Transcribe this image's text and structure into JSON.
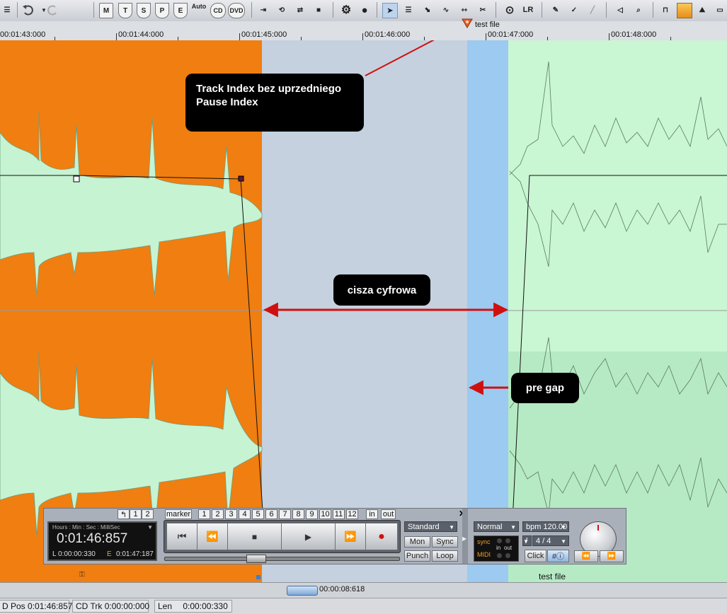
{
  "toolbar": {
    "buttons": [
      "M",
      "T",
      "S",
      "P",
      "E",
      "Auto",
      "CD",
      "DVD"
    ]
  },
  "ruler": {
    "marker_label": "test file",
    "ticks": [
      "00:01:43:000",
      "00:01:44:000",
      "00:01:45:000",
      "00:01:46:000",
      "00:01:47:000",
      "00:01:48:000"
    ]
  },
  "annotations": {
    "track_index": "Track Index bez uprzedniego\nPause Index",
    "silence": "cisza cyfrowa",
    "pregap": "pre gap"
  },
  "track": {
    "bottom_label": "test file"
  },
  "transport": {
    "top_numbers": [
      "1",
      "2"
    ],
    "marker_label": "marker",
    "marker_numbers": [
      "1",
      "2",
      "3",
      "4",
      "5",
      "6",
      "7",
      "8",
      "9",
      "10",
      "11",
      "12"
    ],
    "in_label": "in",
    "out_label": "out",
    "time_header": "Hours : Min :  Sec : MilliSec",
    "time_main": "0:01:46:857",
    "time_l_prefix": "L",
    "time_l": "0:00:00:330",
    "time_e_prefix": "E",
    "time_e": "0:01:47:187",
    "mode_standard": "Standard",
    "mon": "Mon",
    "sync": "Sync",
    "punch": "Punch",
    "loop": "Loop",
    "mode_normal": "Normal",
    "bpm": "bpm 120.00",
    "sig_slash": "/",
    "signature": "4 / 4",
    "sync_label": "sync",
    "midi_label": "MIDI",
    "in_small": "in",
    "out_small": "out",
    "click": "Click"
  },
  "bottombar": {
    "length": "00:00:08:618"
  },
  "status": {
    "pos_label": "D Pos",
    "pos": "0:01:46:857",
    "cdtrk_label": "CD Trk",
    "cdtrk": "0:00:00:000",
    "len_label": "Len",
    "len": "0:00:00:330"
  }
}
